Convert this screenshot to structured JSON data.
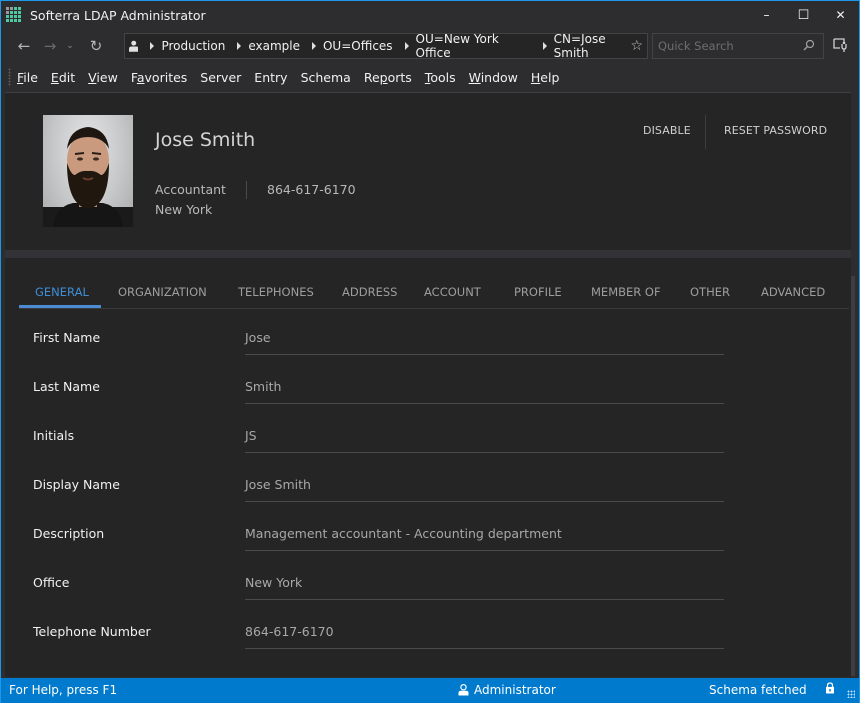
{
  "window": {
    "title": "Softerra LDAP Administrator",
    "controls": {
      "minimize": "–",
      "maximize": "☐",
      "close": "✕"
    },
    "border_color": "#1c97ea"
  },
  "navbar": {
    "back_icon": "←",
    "forward_icon": "→",
    "history_icon": "⌄",
    "refresh_icon": "↻",
    "breadcrumb": [
      {
        "label": "Production"
      },
      {
        "label": "example"
      },
      {
        "label": "OU=Offices"
      },
      {
        "label": "OU=New York Office"
      },
      {
        "label": "CN=Jose Smith"
      }
    ],
    "user_icon": "👤",
    "favorite_icon": "☆",
    "search": {
      "placeholder": "Quick Search",
      "value": "",
      "icon": "⚲"
    },
    "options_icon": "⚙"
  },
  "menubar": {
    "items": [
      {
        "label": "File",
        "mnemonic": "F",
        "rest": "ile"
      },
      {
        "label": "Edit",
        "mnemonic": "E",
        "rest": "dit"
      },
      {
        "label": "View",
        "mnemonic": "V",
        "rest": "iew"
      },
      {
        "label": "Favorites",
        "pre": "F",
        "mnemonic": "a",
        "rest": "vorites"
      },
      {
        "label": "Server",
        "pre": "Server",
        "mnemonic": "",
        "rest": ""
      },
      {
        "label": "Entry",
        "pre": "Entry",
        "mnemonic": "",
        "rest": ""
      },
      {
        "label": "Schema",
        "pre": "Schema",
        "mnemonic": "",
        "rest": ""
      },
      {
        "label": "Reports",
        "pre": "Re",
        "mnemonic": "p",
        "rest": "orts"
      },
      {
        "label": "Tools",
        "mnemonic": "T",
        "rest": "ools"
      },
      {
        "label": "Window",
        "mnemonic": "W",
        "rest": "indow"
      },
      {
        "label": "Help",
        "mnemonic": "H",
        "rest": "elp"
      }
    ]
  },
  "profile": {
    "name": "Jose Smith",
    "title": "Accountant",
    "city": "New York",
    "phone": "864-617-6170",
    "photo_alt": "Photo of Jose Smith",
    "actions": {
      "disable": "DISABLE",
      "reset_password": "RESET PASSWORD"
    }
  },
  "tabs": {
    "active_index": 0,
    "active_color": "#3e8fd6",
    "items": [
      {
        "label": "GENERAL"
      },
      {
        "label": "ORGANIZATION"
      },
      {
        "label": "TELEPHONES"
      },
      {
        "label": "ADDRESS"
      },
      {
        "label": "ACCOUNT"
      },
      {
        "label": "PROFILE"
      },
      {
        "label": "MEMBER OF"
      },
      {
        "label": "OTHER"
      },
      {
        "label": "ADVANCED"
      }
    ]
  },
  "general_form": {
    "fields": [
      {
        "label": "First Name",
        "value": "Jose"
      },
      {
        "label": "Last Name",
        "value": "Smith"
      },
      {
        "label": "Initials",
        "value": "JS"
      },
      {
        "label": "Display Name",
        "value": "Jose Smith"
      },
      {
        "label": "Description",
        "value": "Management accountant - Accounting department"
      },
      {
        "label": "Office",
        "value": "New York"
      },
      {
        "label": "Telephone Number",
        "value": "864-617-6170"
      }
    ]
  },
  "statusbar": {
    "help": "For Help, press F1",
    "user": "Administrator",
    "user_icon": "👤",
    "schema": "Schema fetched",
    "lock_icon": "🔒",
    "color": "#007acc"
  }
}
